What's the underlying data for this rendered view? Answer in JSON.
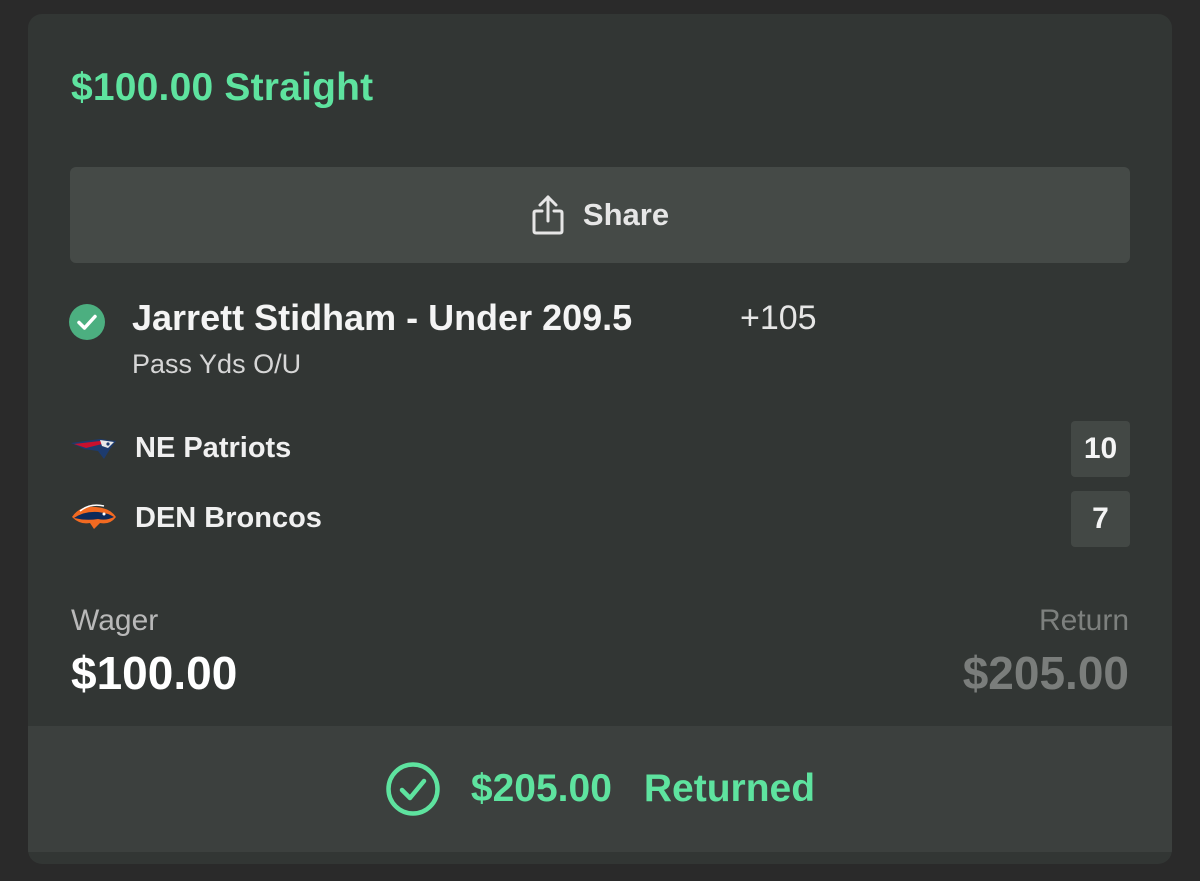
{
  "bet": {
    "title": "$100.00 Straight",
    "share_label": "Share",
    "selection": "Jarrett Stidham - Under 209.5",
    "odds": "+105",
    "market": "Pass Yds O/U"
  },
  "teams": [
    {
      "name": "NE Patriots",
      "score": "10",
      "logo": "patriots-logo-icon"
    },
    {
      "name": "DEN Broncos",
      "score": "7",
      "logo": "broncos-logo-icon"
    }
  ],
  "summary": {
    "wager_label": "Wager",
    "wager_value": "$100.00",
    "return_label": "Return",
    "return_value": "$205.00"
  },
  "footer": {
    "amount": "$205.00",
    "status": "Returned"
  },
  "colors": {
    "accent_green": "#5ee39f",
    "check_green": "#4caf80",
    "card_bg": "#323634",
    "button_bg": "#454a47"
  }
}
